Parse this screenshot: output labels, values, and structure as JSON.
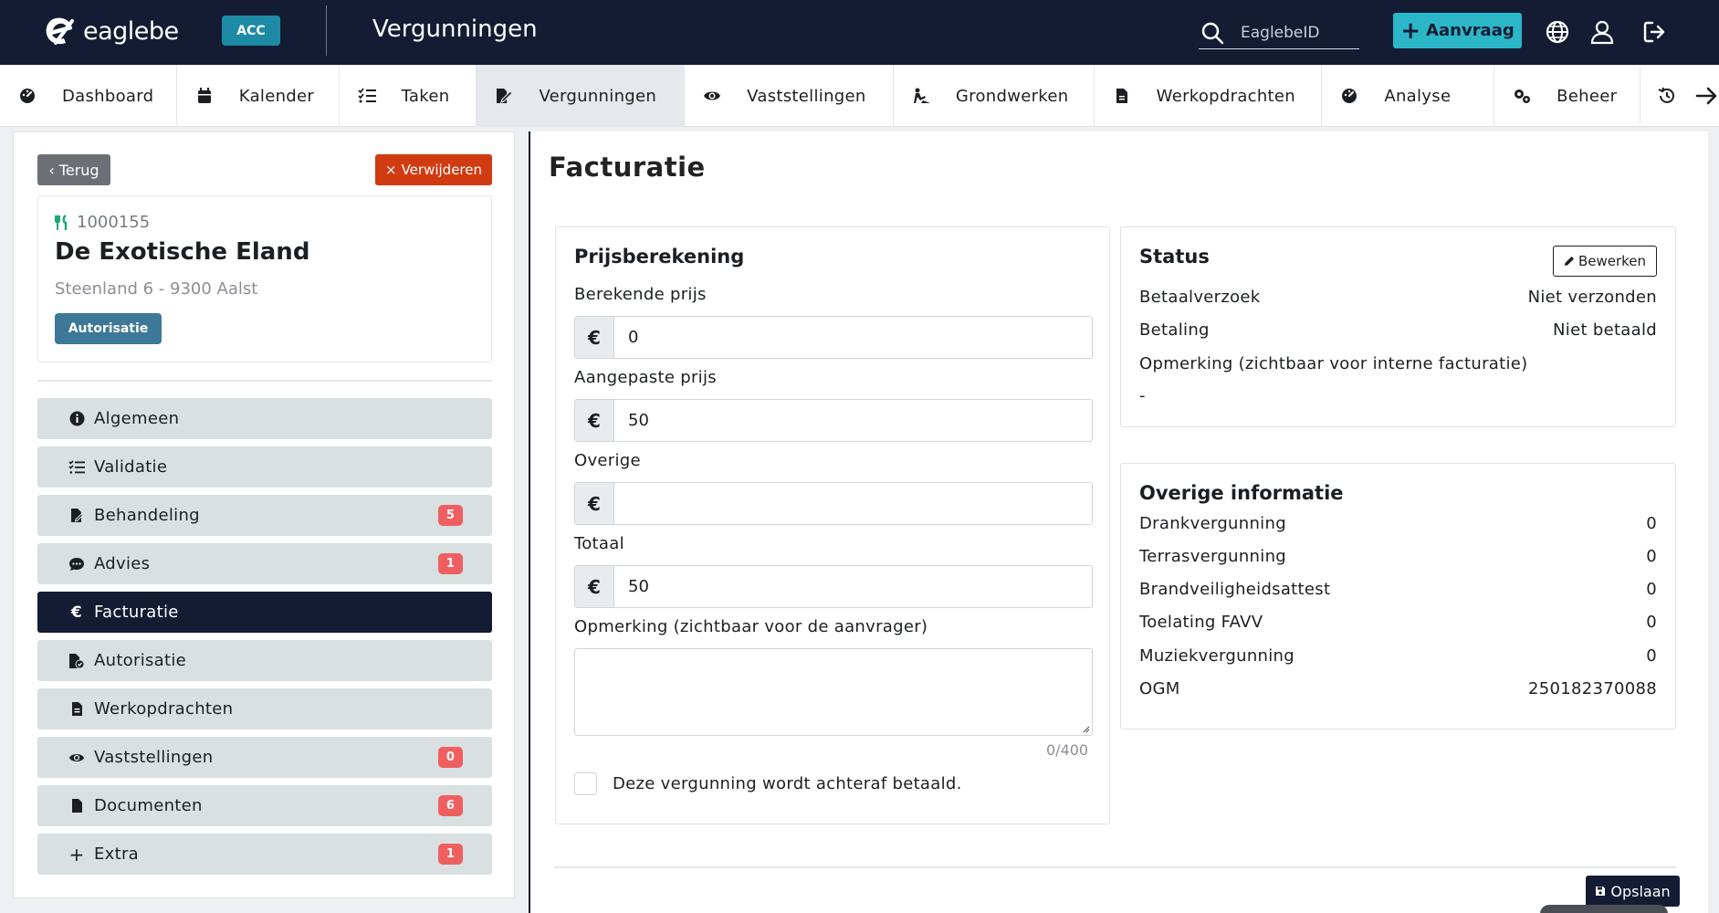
{
  "topbar": {
    "logo_text": "eaglebe",
    "env_badge": "ACC",
    "title": "Vergunningen",
    "search_placeholder": "EaglebeID",
    "new_request_label": "Aanvraag",
    "icons": [
      "globe-icon",
      "user-icon",
      "logout-icon"
    ],
    "colors": {
      "bar": "#141c34",
      "accent": "#2bb7c8",
      "badge": "#1d8ba6"
    }
  },
  "nav": {
    "items": [
      {
        "label": "Dashboard",
        "icon": "dashboard-icon",
        "active": false
      },
      {
        "label": "Kalender",
        "icon": "calendar-icon",
        "active": false
      },
      {
        "label": "Taken",
        "icon": "tasks-icon",
        "active": false
      },
      {
        "label": "Vergunningen",
        "icon": "permit-icon",
        "active": true
      },
      {
        "label": "Vaststellingen",
        "icon": "eye-icon",
        "active": false
      },
      {
        "label": "Grondwerken",
        "icon": "digging-icon",
        "active": false
      },
      {
        "label": "Werkopdrachten",
        "icon": "document-icon",
        "active": false
      },
      {
        "label": "Analyse",
        "icon": "analysis-icon",
        "active": false
      },
      {
        "label": "Beheer",
        "icon": "gears-icon",
        "active": false
      }
    ],
    "end_icons": [
      "history-icon",
      "arrow-right-icon"
    ]
  },
  "left": {
    "back_label": "Terug",
    "delete_label": "Verwijderen",
    "case": {
      "id": "1000155",
      "name": "De Exotische Eland",
      "address": "Steenland 6 - 9300 Aalst",
      "tag": "Autorisatie"
    },
    "menu": [
      {
        "label": "Algemeen",
        "icon": "info-icon",
        "badge": null,
        "active": false
      },
      {
        "label": "Validatie",
        "icon": "checklist-icon",
        "badge": null,
        "active": false
      },
      {
        "label": "Behandeling",
        "icon": "file-edit-icon",
        "badge": "5",
        "active": false
      },
      {
        "label": "Advies",
        "icon": "comment-icon",
        "badge": "1",
        "active": false
      },
      {
        "label": "Facturatie",
        "icon": "euro-icon",
        "badge": null,
        "active": true
      },
      {
        "label": "Autorisatie",
        "icon": "file-check-icon",
        "badge": null,
        "active": false
      },
      {
        "label": "Werkopdrachten",
        "icon": "file-lines-icon",
        "badge": null,
        "active": false
      },
      {
        "label": "Vaststellingen",
        "icon": "eye-icon",
        "badge": "0",
        "active": false
      },
      {
        "label": "Documenten",
        "icon": "file-icon",
        "badge": "6",
        "active": false
      },
      {
        "label": "Extra",
        "icon": "plus-icon",
        "badge": "1",
        "active": false
      }
    ]
  },
  "main": {
    "title": "Facturatie",
    "pricing": {
      "title": "Prijsberekening",
      "currency_symbol": "€",
      "fields": [
        {
          "label": "Berekende prijs",
          "value": "0"
        },
        {
          "label": "Aangepaste prijs",
          "value": "50"
        },
        {
          "label": "Overige",
          "value": ""
        },
        {
          "label": "Totaal",
          "value": "50"
        }
      ],
      "remark_label": "Opmerking (zichtbaar voor de aanvrager)",
      "remark_value": "",
      "counter": "0/400",
      "checkbox_label": "Deze vergunning wordt achteraf betaald.",
      "checkbox_checked": false
    },
    "status": {
      "title": "Status",
      "edit_label": "Bewerken",
      "rows": [
        {
          "label": "Betaalverzoek",
          "value": "Niet verzonden"
        },
        {
          "label": "Betaling",
          "value": "Niet betaald"
        }
      ],
      "remark_label": "Opmerking (zichtbaar voor interne facturatie)",
      "remark_value": "-"
    },
    "other": {
      "title": "Overige informatie",
      "rows": [
        {
          "label": "Drankvergunning",
          "value": "0"
        },
        {
          "label": "Terrasvergunning",
          "value": "0"
        },
        {
          "label": "Brandveiligheidsattest",
          "value": "0"
        },
        {
          "label": "Toelating FAVV",
          "value": "0"
        },
        {
          "label": "Muziekvergunning",
          "value": "0"
        },
        {
          "label": "OGM",
          "value": "250182370088"
        }
      ]
    },
    "save_label": "Opslaan"
  }
}
